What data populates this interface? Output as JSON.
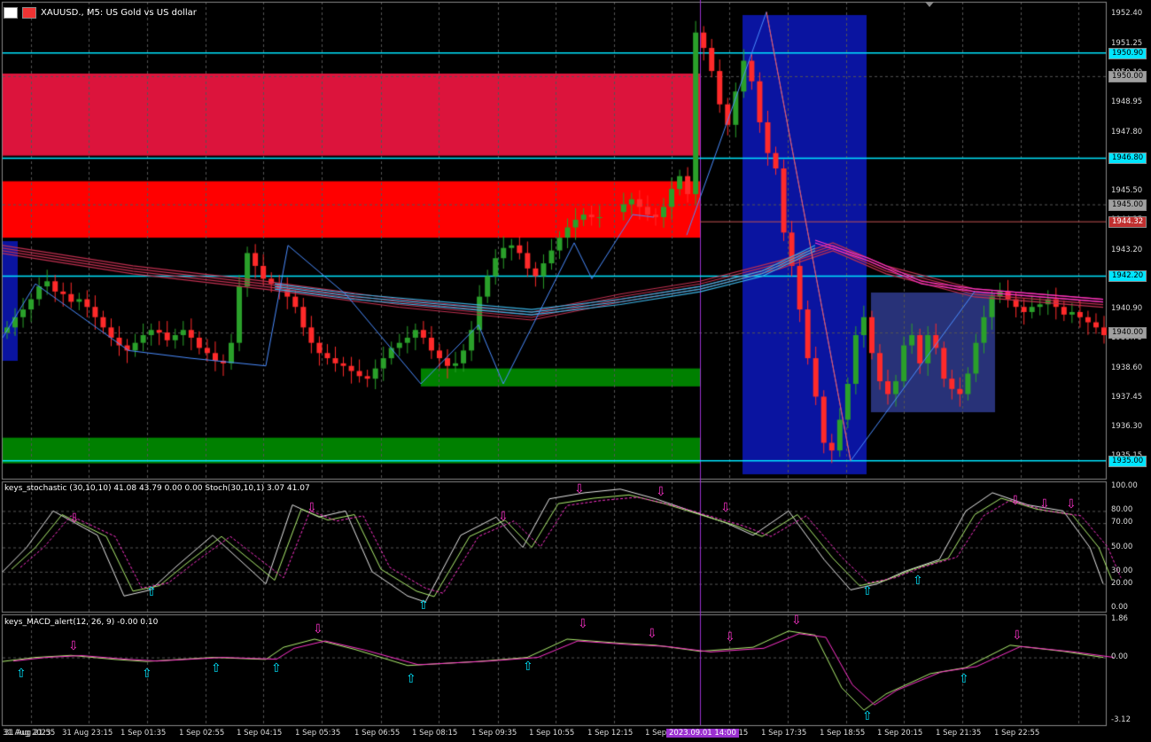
{
  "window": {
    "title": "XAUUSD., M5:  US Gold vs US dollar",
    "icon_names": [
      "chart-grid-icon",
      "bar-chart-icon"
    ]
  },
  "colors": {
    "background": "#000000",
    "grid": "#555555",
    "bull": "#2aa02a",
    "bear": "#ff2a2a",
    "supply_zone_upper": "#dc143c",
    "supply_zone_lower": "#ff0000",
    "demand_zone": "#008000",
    "session_box": "#0a14a0",
    "range_box": "#283278",
    "hline": "#00e5ff",
    "ema_red": "#c03050",
    "ema_blue": "#3cb4e6",
    "magenta": "#ff33cc",
    "stoch_main": "#e6e6e6",
    "stoch_signal": "#b0f070",
    "vline_purple": "#9b30d0"
  },
  "price_axis": {
    "labels": [
      "1952.40",
      "1951.25",
      "1950.10",
      "1948.95",
      "1947.80",
      "1946.65",
      "1945.50",
      "1944.35",
      "1943.20",
      "1942.05",
      "1940.90",
      "1939.75",
      "1938.60",
      "1937.45",
      "1936.30",
      "1935.15"
    ],
    "tags": [
      {
        "text": "1950.90",
        "price": 1950.9,
        "kind": "hline"
      },
      {
        "text": "1950.00",
        "price": 1950.0,
        "kind": "level"
      },
      {
        "text": "1946.80",
        "price": 1946.8,
        "kind": "hline"
      },
      {
        "text": "1945.00",
        "price": 1945.0,
        "kind": "level"
      },
      {
        "text": "1944.32",
        "price": 1944.32,
        "kind": "bid"
      },
      {
        "text": "1942.20",
        "price": 1942.2,
        "kind": "hline"
      },
      {
        "text": "1940.00",
        "price": 1940.0,
        "kind": "level"
      },
      {
        "text": "1935.00",
        "price": 1935.0,
        "kind": "hline"
      }
    ]
  },
  "stoch_pane": {
    "label": "keys_stochastic (30,10,10) 41.08 43.79 0.00 0.00 Stoch(30,10,1) 3.07 41.07",
    "axis_labels": [
      "100.00",
      "80.00",
      "70.00",
      "50.00",
      "30.00",
      "20.00",
      "0.00"
    ],
    "levels": [
      100,
      80,
      70,
      50,
      30,
      20,
      0
    ]
  },
  "macd_pane": {
    "label": "keys_MACD_alert(12, 26, 9) -0.00 0.10",
    "axis_labels": [
      "1.86",
      "0.00",
      "-3.12"
    ],
    "levels": [
      1.86,
      0,
      -3.12
    ]
  },
  "time_axis": {
    "labels": [
      "31 Aug 2023",
      "31 Aug 21:55",
      "31 Aug 23:15",
      "1 Sep 01:35",
      "1 Sep 02:55",
      "1 Sep 04:15",
      "1 Sep 05:35",
      "1 Sep 06:55",
      "1 Sep 08:15",
      "1 Sep 09:35",
      "1 Sep 10:55",
      "1 Sep 12:15",
      "1 Sep 14:55",
      "1 Sep 16:15",
      "1 Sep 17:35",
      "1 Sep 18:55",
      "1 Sep 20:15",
      "1 Sep 21:35",
      "1 Sep 22:55"
    ],
    "highlight": "2023.09.01 14:00"
  },
  "chart_data": {
    "type": "candlestick",
    "symbol": "XAUUSD.",
    "timeframe": "M5",
    "ylim": [
      1934.3,
      1952.9
    ],
    "close_series": [
      1940.2,
      1940.6,
      1940.9,
      1941.3,
      1941.8,
      1942.0,
      1941.6,
      1941.5,
      1941.2,
      1941.3,
      1941.0,
      1940.6,
      1940.2,
      1939.8,
      1939.5,
      1939.3,
      1939.6,
      1939.9,
      1940.1,
      1940.0,
      1939.7,
      1939.9,
      1940.1,
      1939.8,
      1939.4,
      1939.2,
      1938.9,
      1938.8,
      1939.6,
      1941.8,
      1943.1,
      1942.6,
      1942.1,
      1941.9,
      1941.7,
      1941.4,
      1941.0,
      1940.2,
      1939.6,
      1939.2,
      1939.0,
      1938.8,
      1938.7,
      1938.5,
      1938.3,
      1938.2,
      1938.6,
      1939.0,
      1939.4,
      1939.6,
      1939.8,
      1940.1,
      1939.8,
      1939.3,
      1939.0,
      1938.7,
      1938.8,
      1939.3,
      1940.1,
      1941.4,
      1942.2,
      1942.9,
      1943.3,
      1943.4,
      1943.1,
      1942.5,
      1942.2,
      1942.7,
      1943.2,
      1943.7,
      1944.1,
      1944.4,
      1944.6,
      1944.5,
      1944.5,
      null,
      null,
      1945.0,
      1945.2,
      1944.9,
      1944.6,
      1944.5,
      1944.9,
      1945.6,
      1946.1,
      1945.4,
      1951.7,
      1951.1,
      1950.2,
      1948.9,
      1948.1,
      1949.4,
      1950.6,
      1949.8,
      1948.2,
      1947.0,
      1946.4,
      1943.9,
      1942.6,
      1940.9,
      1939.0,
      1937.5,
      1935.7,
      1935.4,
      1936.6,
      1938.0,
      1939.9,
      1940.6,
      1939.2,
      1938.1,
      1937.6,
      1938.1,
      1939.5,
      1939.9,
      1938.8,
      1939.9,
      1939.4,
      1938.2,
      1937.8,
      1937.6,
      1938.4,
      1939.6,
      1940.6,
      1941.4,
      1941.6,
      1941.3,
      1941.0,
      1940.8,
      1941.0,
      1941.1,
      1941.3,
      1941.0,
      1940.7,
      1940.8,
      1940.6,
      1940.4,
      1940.2,
      1939.9
    ],
    "supply_zones": [
      [
        1946.9,
        1950.1
      ],
      [
        1943.7,
        1945.9
      ]
    ],
    "demand_zones": [
      [
        1937.9,
        1938.6
      ],
      [
        1934.9,
        1935.9
      ]
    ],
    "horizontal_lines": [
      1950.9,
      1946.8,
      1942.2,
      1935.0
    ],
    "bid": 1944.32
  }
}
